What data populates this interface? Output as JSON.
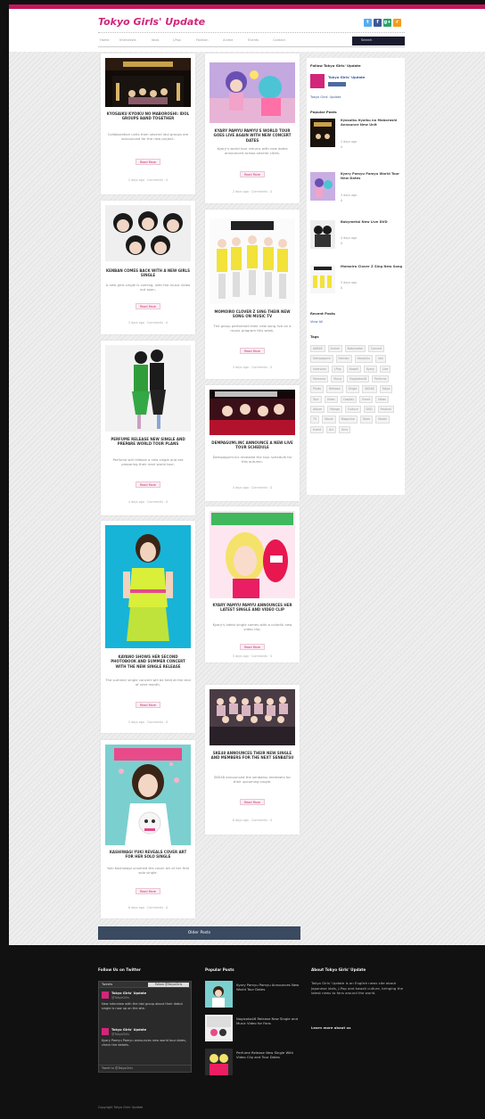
{
  "site": {
    "logo": "Tokyo Girls' Update",
    "accent": "#d1267a"
  },
  "social": [
    {
      "icon": "twitter-icon",
      "glyph": "t",
      "color": "#55acee"
    },
    {
      "icon": "facebook-icon",
      "glyph": "f",
      "color": "#3b5998"
    },
    {
      "icon": "googleplus-icon",
      "glyph": "g+",
      "color": "#2ba36a"
    },
    {
      "icon": "rss-icon",
      "glyph": "r",
      "color": "#f49c1b"
    }
  ],
  "nav": [
    "Home",
    "Interviews",
    "Idols",
    "J-Pop",
    "Fashion",
    "Anime",
    "Events",
    "Contact"
  ],
  "search_placeholder": "Search",
  "read_more": "Read More",
  "left_cards": [
    {
      "title": "Kyosaiku Kyoiku no Maboroshi: Idol Groups Band Together",
      "excerpt": "Collaboration units from several idol groups are announced for the new project.",
      "meta": "2 days ago  ·  Comments  ·  0"
    },
    {
      "title": "Kenban Comes Back with a New Girls Single",
      "excerpt": "A new girls single is coming, with the music video out soon.",
      "meta": "3 days ago  ·  Comments  ·  0"
    },
    {
      "title": "Perfume Release New Single and Prepare World Tour Plans",
      "excerpt": "Perfume will release a new single and are preparing their next world tour.",
      "meta": "4 days ago  ·  Comments  ·  0"
    },
    {
      "title": "Kayano Shows Her Second Photobook and Summer Concert with the New Single Release",
      "excerpt": "The summer single concert will be held at the end of next month.",
      "meta": "5 days ago  ·  Comments  ·  0"
    },
    {
      "title": "Kashiwagi Yuki Reveals Cover Art for Her Solo Single",
      "excerpt": "Yuki Kashiwagi unveiled the cover art of her first solo single.",
      "meta": "6 days ago  ·  Comments  ·  0"
    }
  ],
  "right_cards": [
    {
      "title": "Kyary Pamyu Pamyu's World Tour Goes Live Again With New Concert Dates",
      "excerpt": "Kyary's world tour returns with new dates announced across several cities.",
      "meta": "2 days ago  ·  Comments  ·  0"
    },
    {
      "title": "Momoiro Clover Z Sing Their New Song on Music TV",
      "excerpt": "The group performed their new song live on a music program this week.",
      "meta": "3 days ago  ·  Comments  ·  0"
    },
    {
      "title": "Dempagumi.inc Announce a New Live Tour Schedule",
      "excerpt": "Dempagumi.inc revealed the tour schedule for this autumn.",
      "meta": "4 days ago  ·  Comments  ·  0"
    },
    {
      "title": "Kyary Pamyu Pamyu Announces Her Latest Single and Video Clip",
      "excerpt": "Kyary's latest single comes with a colorful new video clip.",
      "meta": "5 days ago  ·  Comments  ·  0"
    },
    {
      "title": "SKE48 Announces Their New Single and Members for the Next Senbatsu",
      "excerpt": "SKE48 announced the senbatsu members for their upcoming single.",
      "meta": "6 days ago  ·  Comments  ·  0"
    }
  ],
  "sidebar": {
    "follow_heading": "Follow Tokyo Girls' Update",
    "like_name": "Tokyo Girls' Update",
    "like_link": "Tokyo Girls' Update",
    "popular_heading": "Popular Posts",
    "posts": [
      {
        "title": "Kyosaiku Kyoiku no Maboroshi Announce New Unit",
        "meta1": "2 days ago",
        "meta2": "0"
      },
      {
        "title": "Kyary Pamyu Pamyu World Tour New Dates",
        "meta1": "3 days ago",
        "meta2": "0"
      },
      {
        "title": "Babymetal New Live DVD",
        "meta1": "4 days ago",
        "meta2": "0"
      },
      {
        "title": "Momoiro Clover Z Sing New Song",
        "meta1": "5 days ago",
        "meta2": "0"
      }
    ],
    "recent_heading": "Recent Posts",
    "recent_link": "View All",
    "tags_heading": "Tags",
    "tags": [
      "AKB48",
      "Anime",
      "Babymetal",
      "Concert",
      "Dempagumi",
      "Fashion",
      "Harajuku",
      "Idol",
      "Interview",
      "J-Pop",
      "Kawaii",
      "Kyary",
      "Live",
      "Momoclo",
      "Music",
      "Nogizaka46",
      "Perfume",
      "Photo",
      "Release",
      "Single",
      "SKE48",
      "Tokyo",
      "Tour",
      "Video",
      "Cosplay",
      "Event",
      "News",
      "Album",
      "Manga",
      "Culture",
      "DVD",
      "Festival",
      "TV",
      "Movie",
      "Magazine",
      "Team",
      "Model",
      "Event",
      "Art",
      "Girls"
    ]
  },
  "older_posts": "Older Posts",
  "footer": {
    "twitter_heading": "Follow Us on Twitter",
    "tw_tab": "Tweets",
    "tw_follow": "Follow @TokyoGirls",
    "tweets": [
      {
        "name": "Tokyo Girls' Update",
        "handle": "@TokyoGirls",
        "text": "New interview with the idol group about their debut single is now up on the site."
      },
      {
        "name": "Tokyo Girls' Update",
        "handle": "@TokyoGirls",
        "text": "Kyary Pamyu Pamyu announces new world tour dates, check the details."
      }
    ],
    "tw_footer": "Tweet to @TokyoGirls",
    "popular_heading": "Popular Posts",
    "fposts": [
      "Kyary Pamyu Pamyu Announces New World Tour Dates",
      "Nogizaka46 Release New Single and Music Video for Fans",
      "Perfume Release New Single With Video Clip and Tour Dates"
    ],
    "about_heading": "About Tokyo Girls' Update",
    "about_text": "Tokyo Girls' Update is an English news site about Japanese idols, J-Pop and kawaii culture, bringing the latest news to fans around the world.",
    "about_link": "Learn more about us",
    "copyright": "Copyright Tokyo Girls' Update"
  }
}
